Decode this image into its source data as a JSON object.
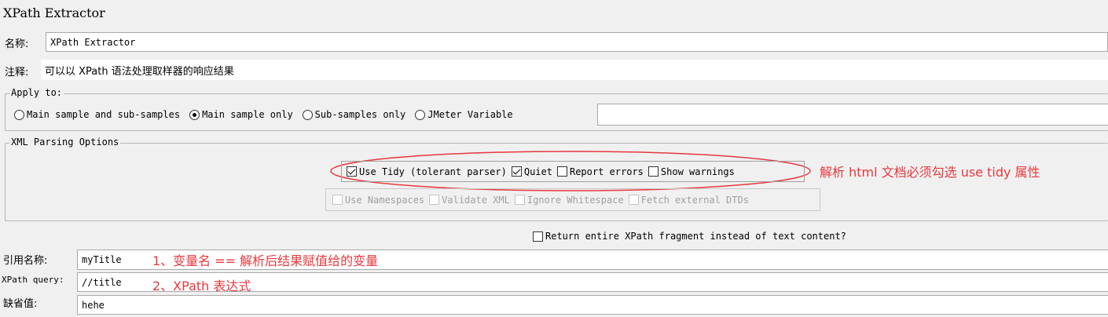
{
  "window": {
    "title": "XPath Extractor"
  },
  "name": {
    "label": "名称:",
    "value": "XPath Extractor"
  },
  "comment": {
    "label": "注释:",
    "value": "可以以 XPath 语法处理取样器的响应结果"
  },
  "apply_to": {
    "legend": "Apply to:",
    "options": [
      "Main sample and sub-samples",
      "Main sample only",
      "Sub-samples only",
      "JMeter Variable"
    ],
    "selected": "Main sample only",
    "variable_value": ""
  },
  "xml_parsing": {
    "legend": "XML Parsing Options",
    "use_tidy": {
      "label": "Use Tidy (tolerant parser)",
      "checked": true
    },
    "quiet": {
      "label": "Quiet",
      "checked": true
    },
    "report_errors": {
      "label": "Report errors",
      "checked": false
    },
    "show_warnings": {
      "label": "Show warnings",
      "checked": false
    },
    "disabled_options": [
      "Use Namespaces",
      "Validate XML",
      "Ignore Whitespace",
      "Fetch external DTDs"
    ],
    "annotation": "解析 html 文档必须勾选 use tidy 属性"
  },
  "return_fragment": {
    "label": "Return entire XPath fragment instead of text content?",
    "checked": false
  },
  "reference_name": {
    "label": "引用名称:",
    "value": "myTitle",
    "annotation": "1、变量名 == 解析后结果赋值给的变量"
  },
  "xpath_query": {
    "label": "XPath query:",
    "value": "//title",
    "annotation": "2、XPath 表达式"
  },
  "default_value": {
    "label": "缺省值:",
    "value": "hehe"
  },
  "colors": {
    "annotation_red": "#e8383d",
    "background": "#f0f0f0"
  }
}
